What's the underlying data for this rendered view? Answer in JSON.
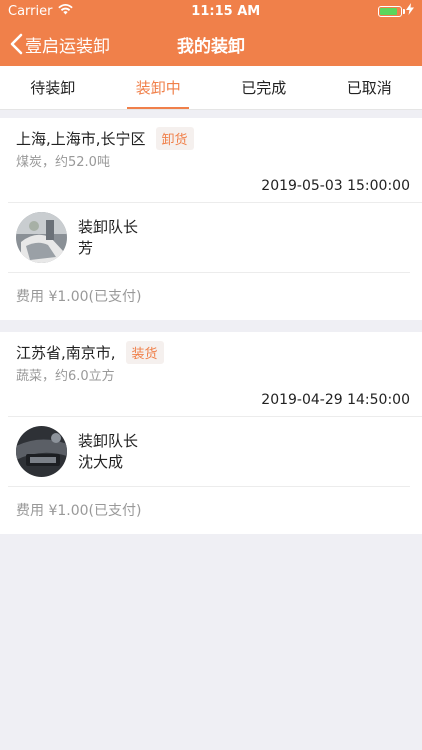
{
  "status_bar": {
    "carrier": "Carrier",
    "time": "11:15 AM"
  },
  "nav": {
    "back_label": "壹启运装卸",
    "title": "我的装卸"
  },
  "tabs": [
    {
      "label": "待装卸"
    },
    {
      "label": "装卸中"
    },
    {
      "label": "已完成"
    },
    {
      "label": "已取消"
    }
  ],
  "orders": [
    {
      "location": "上海,上海市,长宁区",
      "tag": "卸货",
      "cargo": "煤炭，约52.0吨",
      "time": "2019-05-03 15:00:00",
      "leader_title": "装卸队长",
      "leader_name": "芳",
      "fee": "费用 ¥1.00(已支付)"
    },
    {
      "location": "江苏省,南京市,",
      "tag": "装货",
      "cargo": "蔬菜，约6.0立方",
      "time": "2019-04-29 14:50:00",
      "leader_title": "装卸队长",
      "leader_name": "沈大成",
      "fee": "费用 ¥1.00(已支付)"
    }
  ],
  "colors": {
    "accent": "#f0804a",
    "background": "#efeff4",
    "muted": "#999999"
  }
}
